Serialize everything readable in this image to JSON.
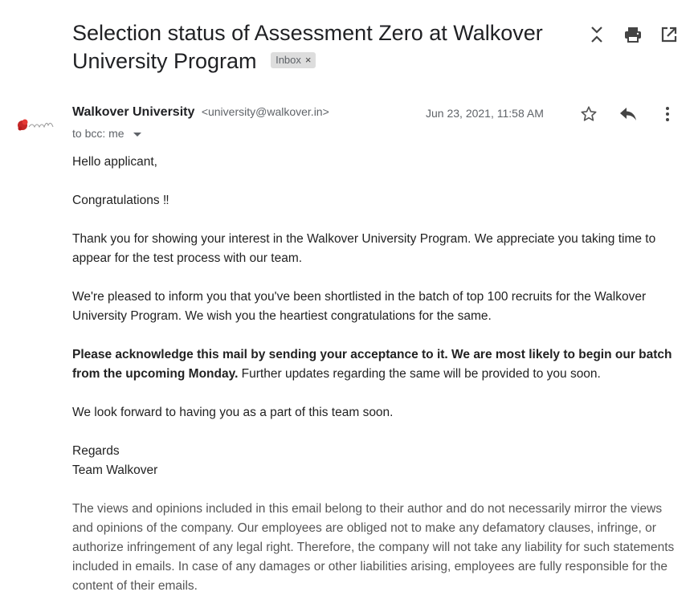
{
  "subject": "Selection status of Assessment Zero at Walkover University Program",
  "label_chip": {
    "text": "Inbox",
    "remove": "×"
  },
  "toolbar": {
    "collapse_icon": "collapse-all-icon",
    "print_icon": "print-icon",
    "popout_icon": "open-in-new-window-icon"
  },
  "sender": {
    "name": "Walkover University",
    "email": "<university@walkover.in>",
    "date": "Jun 23, 2021, 11:58 AM",
    "to": "to bcc: me"
  },
  "actions": {
    "star_icon": "star-icon",
    "reply_icon": "reply-icon",
    "more_icon": "more-vert-icon"
  },
  "body": {
    "greeting": "Hello applicant,",
    "congrats": "Congratulations ‼",
    "p1": "Thank you for showing your interest in the Walkover University Program. We appreciate you taking time to appear for the test process with our team.",
    "p2": "We're pleased to inform you that you've been shortlisted in the batch of top 100 recruits for the Walkover University Program. We wish you the heartiest congratulations for the same.",
    "p3_bold": "Please acknowledge this mail by sending your acceptance to it. We are most likely to begin our batch from the upcoming Monday.",
    "p3_rest": " Further updates regarding the same will be provided to you soon.",
    "p4": "We look forward to having you as a part of this team soon.",
    "regards": "Regards",
    "signature": "Team Walkover",
    "disclaimer": "The views and opinions included in this email belong to their author and do not necessarily mirror the views and opinions of the company. Our employees are obliged not to make any defamatory clauses, infringe, or authorize infringement of any legal right. Therefore, the company will not take any liability for such statements included in emails. In case of any damages or other liabilities arising, employees are fully responsible for the content of their emails."
  }
}
